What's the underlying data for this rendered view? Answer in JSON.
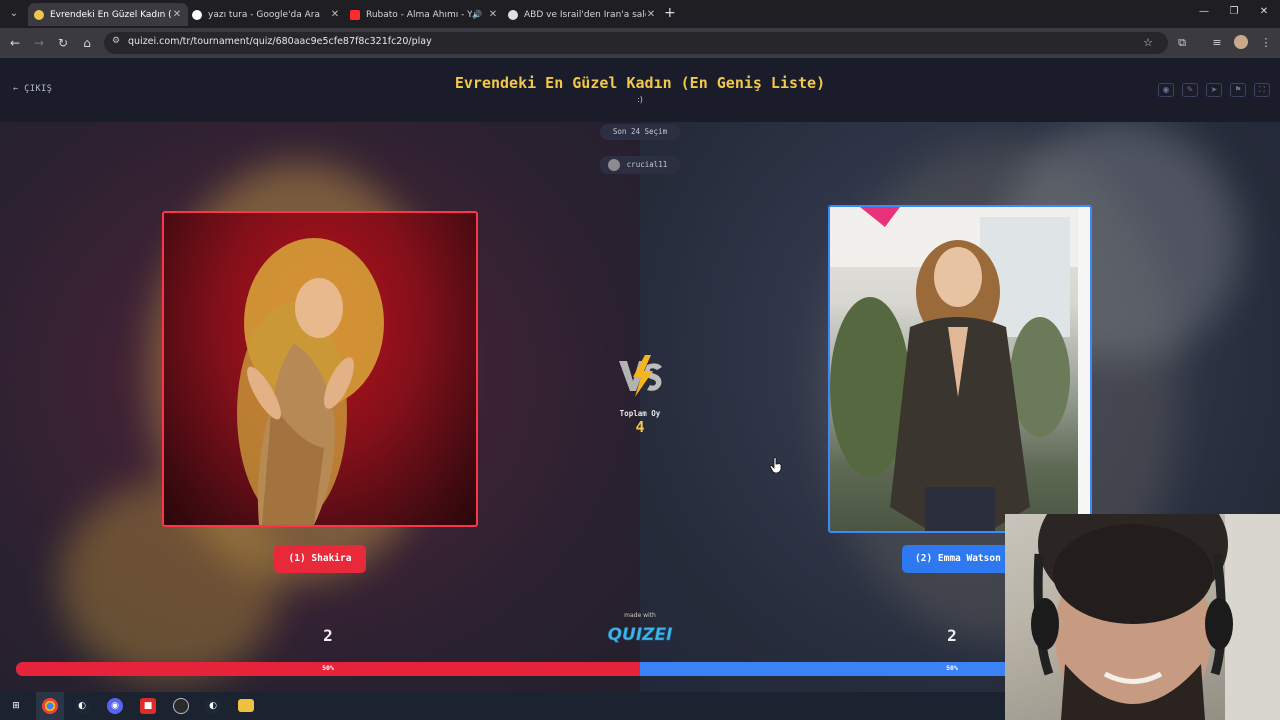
{
  "browser": {
    "tabs": [
      {
        "title": "Evrendeki En Güzel Kadın (En G",
        "active": true,
        "favicon_color": "#f1c84a"
      },
      {
        "title": "yazı tura - Google'da Ara",
        "active": false,
        "favicon_color": "#ffffff"
      },
      {
        "title": "Rubato - Alma Ahımı - You",
        "active": false,
        "favicon_color": "#ff2a2a",
        "audio": true
      },
      {
        "title": "ABD ve İsrail'den İran'a saldırı",
        "active": false,
        "favicon_color": "#e0e0e0"
      }
    ],
    "url": "quizei.com/tr/tournament/quiz/680aac9e5cfe87f8c321fc20/play"
  },
  "header": {
    "exit_label": "ÇIKIŞ",
    "title": "Evrendeki En Güzel Kadın (En Geniş Liste)",
    "subtitle": ":)"
  },
  "match": {
    "round_label": "Son 24 Seçim",
    "username": "crucial11",
    "total_label": "Toplam Oy",
    "total_value": "4",
    "left": {
      "name": "(1) Shakira",
      "votes": "2",
      "percent_label": "50%",
      "percent": 50,
      "color": "#e6233a"
    },
    "right": {
      "name": "(2) Emma Watson",
      "votes": "2",
      "percent_label": "50%",
      "percent": 50,
      "color": "#3a82f6"
    },
    "made_with": "made with",
    "brand": "QUIZEI"
  },
  "icons": {
    "header_actions": [
      "eye-icon",
      "edit-icon",
      "share-icon",
      "flag-icon",
      "fullscreen-icon"
    ],
    "taskbar": [
      "windows-start-icon",
      "chrome-icon",
      "steam-icon",
      "discord-icon",
      "app-icon",
      "obs-icon",
      "steam-icon-2",
      "folder-icon"
    ]
  }
}
